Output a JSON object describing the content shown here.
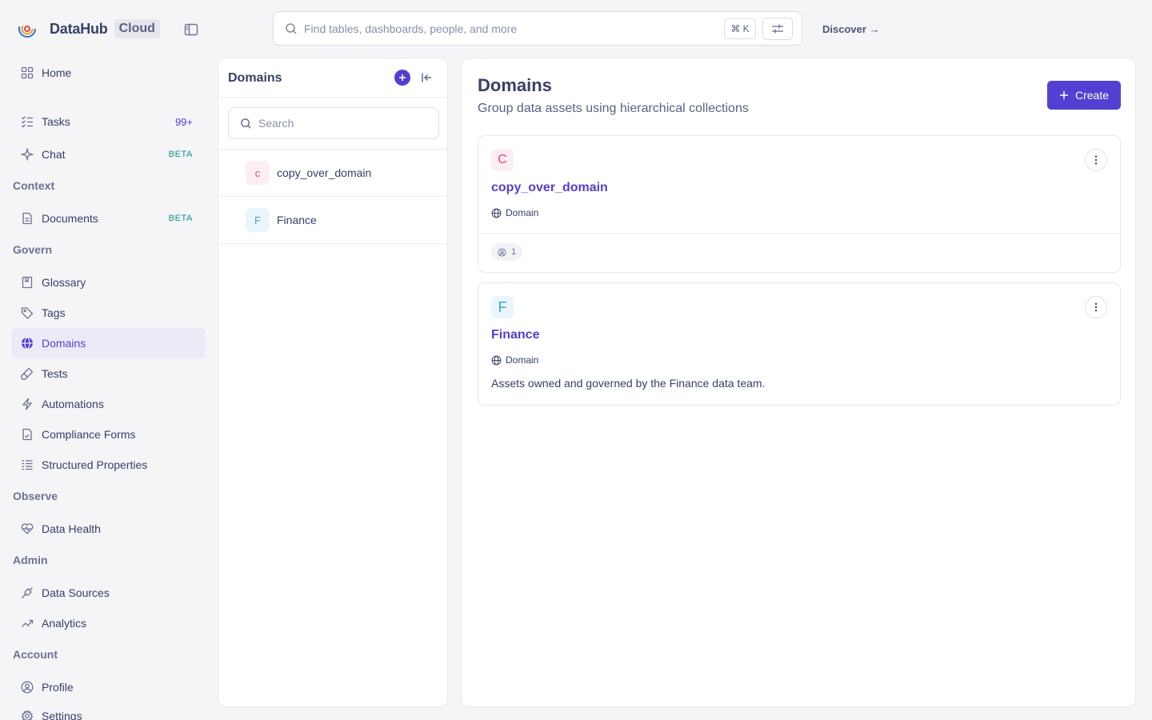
{
  "brand": {
    "name": "DataHub",
    "badge": "Cloud"
  },
  "search": {
    "placeholder": "Find tables, dashboards, people, and more",
    "shortcut": "⌘ K"
  },
  "header": {
    "discover_label": "Discover →"
  },
  "sidebar": {
    "items": [
      {
        "label": "Home",
        "icon": "grid-icon"
      },
      {
        "label": "Tasks",
        "icon": "checklist-icon",
        "badge": "99+"
      },
      {
        "label": "Chat",
        "icon": "sparkle-icon",
        "tag": "BETA"
      }
    ],
    "sections": {
      "context": {
        "title": "Context",
        "items": [
          {
            "label": "Documents",
            "icon": "document-icon",
            "tag": "BETA"
          }
        ]
      },
      "govern": {
        "title": "Govern",
        "items": [
          {
            "label": "Glossary",
            "icon": "book-icon"
          },
          {
            "label": "Tags",
            "icon": "tag-icon"
          },
          {
            "label": "Domains",
            "icon": "globe-icon",
            "active": true
          },
          {
            "label": "Tests",
            "icon": "test-tube-icon"
          },
          {
            "label": "Automations",
            "icon": "lightning-icon"
          },
          {
            "label": "Compliance Forms",
            "icon": "form-icon"
          },
          {
            "label": "Structured Properties",
            "icon": "list-icon"
          }
        ]
      },
      "observe": {
        "title": "Observe",
        "items": [
          {
            "label": "Data Health",
            "icon": "heart-pulse-icon"
          }
        ]
      },
      "admin": {
        "title": "Admin",
        "items": [
          {
            "label": "Data Sources",
            "icon": "plug-icon"
          },
          {
            "label": "Analytics",
            "icon": "trend-icon"
          }
        ]
      },
      "account": {
        "title": "Account",
        "items": [
          {
            "label": "Profile",
            "icon": "user-circle-icon"
          },
          {
            "label": "Settings",
            "icon": "gear-icon"
          }
        ]
      }
    }
  },
  "domains_panel": {
    "title": "Domains",
    "search_placeholder": "Search",
    "items": [
      {
        "initial": "c",
        "label": "copy_over_domain",
        "color": "#e0457b",
        "bg": "#fdeef3"
      },
      {
        "initial": "F",
        "label": "Finance",
        "color": "#3aa3d9",
        "bg": "#eaf6fc"
      }
    ]
  },
  "main": {
    "title": "Domains",
    "subtitle": "Group data assets using hierarchical collections",
    "create_label": "Create",
    "accent": "#533fd1",
    "cards": [
      {
        "initial": "C",
        "name": "copy_over_domain",
        "type": "Domain",
        "owners_count": "1",
        "color": "#e0457b",
        "bg": "#fdeef3"
      },
      {
        "initial": "F",
        "name": "Finance",
        "type": "Domain",
        "description": "Assets owned and governed by the Finance data team.",
        "color": "#3aa3d9",
        "bg": "#eaf6fc"
      }
    ]
  }
}
